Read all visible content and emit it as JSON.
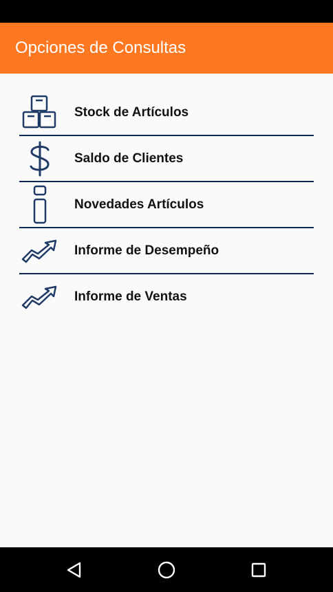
{
  "app_bar": {
    "title": "Opciones de Consultas",
    "color": "#fd7821"
  },
  "menu": {
    "items": [
      {
        "label": "Stock de Artículos",
        "icon": "boxes-icon"
      },
      {
        "label": "Saldo de Clientes",
        "icon": "dollar-icon"
      },
      {
        "label": "Novedades Artículos",
        "icon": "info-icon"
      },
      {
        "label": "Informe de Desempeño",
        "icon": "trend-up-icon"
      },
      {
        "label": "Informe de Ventas",
        "icon": "trend-up-icon"
      }
    ],
    "divider_color": "#10285a",
    "icon_color": "#1f3a66"
  },
  "nav_bar": {
    "buttons": [
      {
        "icon": "back-triangle-icon"
      },
      {
        "icon": "home-circle-icon"
      },
      {
        "icon": "recents-square-icon"
      }
    ]
  }
}
